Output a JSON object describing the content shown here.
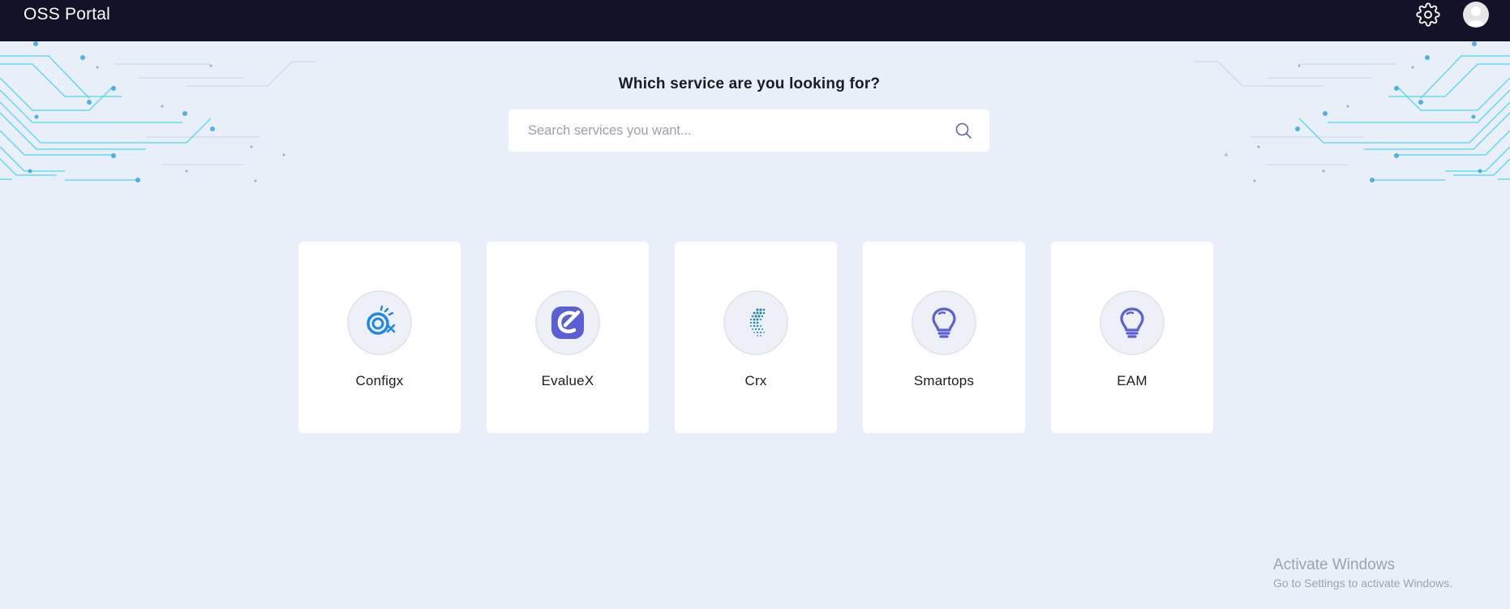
{
  "header": {
    "title": "OSS Portal",
    "settings_icon": "gear-icon",
    "profile_icon": "avatar"
  },
  "main": {
    "prompt": "Which service are you looking for?",
    "search": {
      "placeholder": "Search services you want...",
      "value": "",
      "icon": "search-icon"
    },
    "services": [
      {
        "label": "Configx",
        "icon": "configx-logo-icon"
      },
      {
        "label": "EvalueX",
        "icon": "evaluex-logo-icon"
      },
      {
        "label": "Crx",
        "icon": "crx-logo-icon"
      },
      {
        "label": "Smartops",
        "icon": "lightbulb-icon"
      },
      {
        "label": "EAM",
        "icon": "lightbulb-icon"
      }
    ]
  },
  "watermark": {
    "title": "Activate Windows",
    "subtitle": "Go to Settings to activate Windows."
  },
  "colors": {
    "topbar": "#121328",
    "background": "#e9eff9",
    "accent": "#5a5fd3",
    "circuit": "#35d3ee"
  }
}
